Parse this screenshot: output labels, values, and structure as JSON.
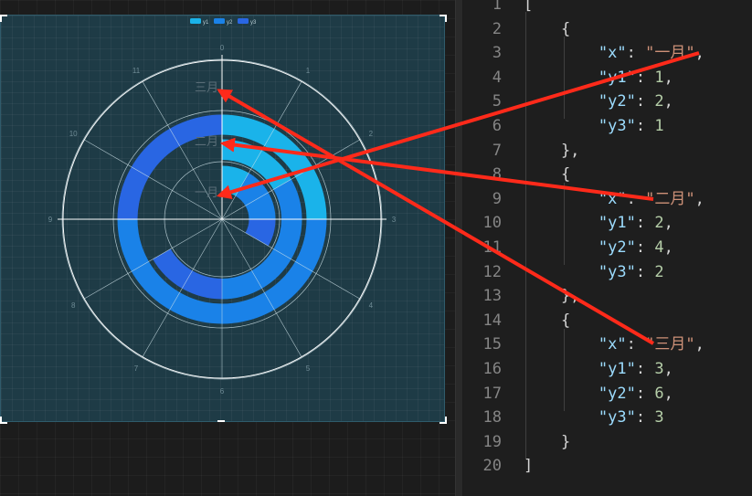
{
  "chart_data": {
    "type": "polar-bar",
    "categories": [
      "一月",
      "二月",
      "三月"
    ],
    "series": [
      {
        "name": "y1",
        "values": [
          1,
          2,
          3
        ],
        "color": "#1ab3ea"
      },
      {
        "name": "y2",
        "values": [
          2,
          4,
          6
        ],
        "color": "#1a82e8"
      },
      {
        "name": "y3",
        "values": [
          1,
          2,
          3
        ],
        "color": "#2966e3"
      }
    ],
    "angle_ticks": [
      "0",
      "1",
      "2",
      "3",
      "4",
      "5",
      "6",
      "7",
      "8",
      "9",
      "10",
      "11"
    ],
    "angle_max": 12,
    "legend": {
      "position": "top-center",
      "items": [
        "y1",
        "y2",
        "y3"
      ]
    },
    "stacked": true,
    "grid": true
  },
  "editor": {
    "lines": [
      {
        "n": "1",
        "text": "["
      },
      {
        "n": "2",
        "text": "{"
      },
      {
        "n": "3",
        "key": "\"x\"",
        "sval": "\"一月\"",
        "tail": ","
      },
      {
        "n": "4",
        "key": "\"y1\"",
        "nval": "1",
        "tail": ","
      },
      {
        "n": "5",
        "key": "\"y2\"",
        "nval": "2",
        "tail": ","
      },
      {
        "n": "6",
        "key": "\"y3\"",
        "nval": "1",
        "tail": ""
      },
      {
        "n": "7",
        "text": "},"
      },
      {
        "n": "8",
        "text": "{"
      },
      {
        "n": "9",
        "key": "\"x\"",
        "sval": "\"二月\"",
        "tail": ","
      },
      {
        "n": "10",
        "key": "\"y1\"",
        "nval": "2",
        "tail": ","
      },
      {
        "n": "11",
        "key": "\"y2\"",
        "nval": "4",
        "tail": ","
      },
      {
        "n": "12",
        "key": "\"y3\"",
        "nval": "2",
        "tail": ""
      },
      {
        "n": "13",
        "text": "},"
      },
      {
        "n": "14",
        "text": "{"
      },
      {
        "n": "15",
        "key": "\"x\"",
        "sval": "\"三月\"",
        "tail": ","
      },
      {
        "n": "16",
        "key": "\"y1\"",
        "nval": "3",
        "tail": ","
      },
      {
        "n": "17",
        "key": "\"y2\"",
        "nval": "6",
        "tail": ","
      },
      {
        "n": "18",
        "key": "\"y3\"",
        "nval": "3",
        "tail": ""
      },
      {
        "n": "19",
        "text": "}"
      },
      {
        "n": "20",
        "text": "]"
      }
    ]
  },
  "colors": {
    "annotation_arrow": "#ff2a1a",
    "chart_bg": "#1e3b46"
  }
}
